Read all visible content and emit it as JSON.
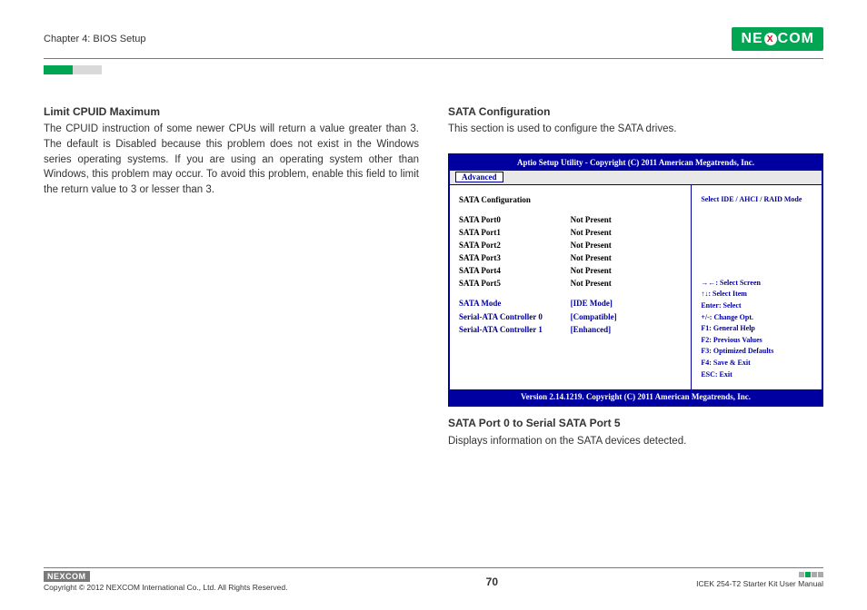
{
  "header": {
    "chapter": "Chapter 4: BIOS Setup",
    "logo": "NE COM",
    "logoX": "X"
  },
  "left": {
    "h": "Limit CPUID Maximum",
    "p": "The CPUID instruction of some newer CPUs will return a value greater than 3. The default is Disabled because this problem does not exist in the Windows series operating systems. If you are using an operating system other than Windows, this problem may occur. To avoid this problem, enable this field to limit the return value to 3 or lesser than 3."
  },
  "right": {
    "h1": "SATA Configuration",
    "p1": "This section is used to configure the SATA drives.",
    "bios": {
      "title": "Aptio Setup Utility - Copyright (C) 2011 American Megatrends, Inc.",
      "tab": "Advanced",
      "section": "SATA Configuration",
      "ports": [
        {
          "lbl": "SATA Port0",
          "val": "Not Present"
        },
        {
          "lbl": "SATA Port1",
          "val": "Not Present"
        },
        {
          "lbl": "SATA Port2",
          "val": "Not Present"
        },
        {
          "lbl": "SATA Port3",
          "val": "Not Present"
        },
        {
          "lbl": "SATA Port4",
          "val": "Not Present"
        },
        {
          "lbl": "SATA Port5",
          "val": "Not Present"
        }
      ],
      "opts": [
        {
          "lbl": "SATA Mode",
          "val": "[IDE Mode]"
        },
        {
          "lbl": "Serial-ATA Controller 0",
          "val": "[Compatible]"
        },
        {
          "lbl": "Serial-ATA Controller 1",
          "val": "[Enhanced]"
        }
      ],
      "hint": "Select IDE / AHCI / RAID Mode",
      "help": [
        "→←: Select Screen",
        "↑↓: Select Item",
        "Enter: Select",
        "+/-: Change Opt.",
        "F1: General Help",
        "F2: Previous Values",
        "F3: Optimized Defaults",
        "F4: Save & Exit",
        "ESC: Exit"
      ],
      "footer": "Version 2.14.1219. Copyright (C) 2011 American Megatrends, Inc."
    },
    "h2": "SATA Port 0 to Serial SATA Port 5",
    "p2": "Displays information on the SATA devices detected."
  },
  "footer": {
    "logo": "NEXCOM",
    "copy": "Copyright © 2012 NEXCOM International Co., Ltd. All Rights Reserved.",
    "page": "70",
    "manual": "ICEK 254-T2 Starter Kit User Manual"
  }
}
